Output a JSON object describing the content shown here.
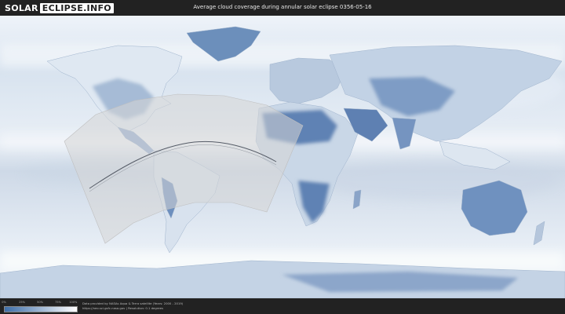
{
  "header": {
    "logo_part1": "SOLAR",
    "logo_part2": "ECLIPSE.INFO",
    "title": "Average cloud coverage during annular solar eclipse 0356-05-16"
  },
  "legend": {
    "ticks": [
      "0%",
      "25%",
      "50%",
      "75%",
      "100%"
    ],
    "color_low": "#3e6ea8",
    "color_high": "#ffffff"
  },
  "credits": {
    "line1": "Data provided by NASAs Aqua & Terra satellite (Years: 2000 - 2019)",
    "line2": "https://neo.sci.gsfc.nasa.gov | Resolution: 0.1 degrees"
  },
  "map": {
    "colors": {
      "ocean": "#dce7f2",
      "land_clear": "#6f90bd",
      "cloud": "#f4f8fc",
      "visibility_zone": "#d9d9d9"
    }
  }
}
